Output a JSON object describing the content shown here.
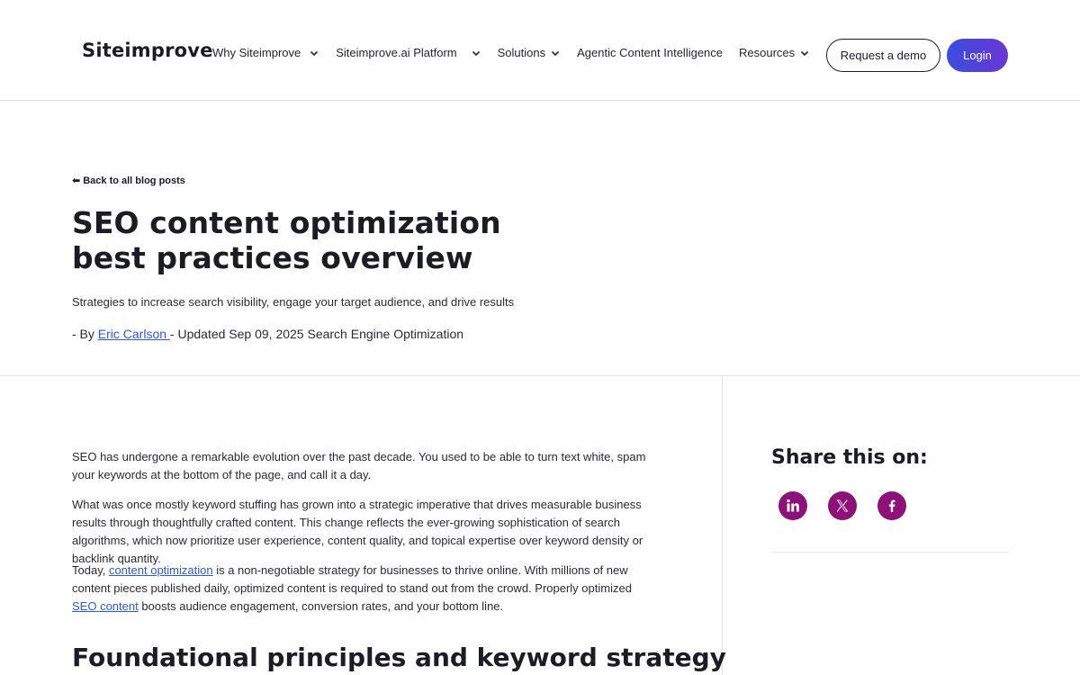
{
  "header": {
    "logo": "Siteimprove",
    "nav": [
      {
        "label": "Why Siteimprove",
        "has_dropdown": true
      },
      {
        "label": "Siteimprove.ai Platform",
        "has_dropdown": true
      },
      {
        "label": "Solutions",
        "has_dropdown": true
      },
      {
        "label": "Agentic Content Intelligence",
        "has_dropdown": false
      },
      {
        "label": "Resources",
        "has_dropdown": true
      }
    ],
    "demo_button": "Request a demo",
    "login_button": "Login"
  },
  "hero": {
    "back_link": "Back to all blog posts",
    "back_icon": "arrow-left-icon",
    "title": "SEO content optimization best practices overview",
    "subtitle": "Strategies to increase search visibility, engage your target audience, and drive results",
    "meta_prefix": "- By ",
    "author": "Eric Carlson ",
    "meta_updated": "- Updated Sep 09, 2025 Search Engine Optimization"
  },
  "article": {
    "p1": "SEO has undergone a remarkable evolution over the past decade. You used to be able to turn text white, spam your keywords at the bottom of the page, and call it a day.",
    "p2": "What was once mostly keyword stuffing has grown into a strategic imperative that drives measurable business results through thoughtfully crafted content. This change reflects the ever-growing sophistication of search algorithms, which now prioritize user experience, content quality, and topical expertise over keyword density or backlink quantity.",
    "p3_before": "Today, ",
    "p3_link1": "content optimization",
    "p3_middle": " is a non-negotiable strategy for businesses to thrive online. With millions of new content pieces published daily, optimized content is required to stand out from the crowd. Properly optimized ",
    "p3_link2": "SEO content",
    "p3_after": " boosts audience engagement, conversion rates, and your bottom line.",
    "section_heading": "Foundational principles and keyword strategy"
  },
  "sidebar": {
    "share_title": "Share this on:",
    "share_icons": [
      "linkedin-icon",
      "x-icon",
      "facebook-icon"
    ]
  },
  "colors": {
    "link": "#2a59d8",
    "share_bg": "#8d1178",
    "login_gradient_start": "#3b4de0",
    "login_gradient_end": "#6a37d3",
    "text": "#1c1c24"
  }
}
